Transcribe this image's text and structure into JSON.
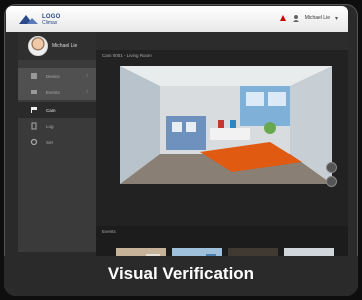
{
  "app": {
    "logo_line1": "LOGO",
    "logo_line2": "Climax"
  },
  "topbar": {
    "username": "Michael Lie"
  },
  "sidebar": {
    "profile_name": "Michael Lie",
    "items": [
      {
        "label": "Device"
      },
      {
        "label": "Events"
      },
      {
        "label": "Cam"
      },
      {
        "label": "Log"
      },
      {
        "label": "Set"
      }
    ]
  },
  "camera": {
    "title": "Cam 0001 - Living Room"
  },
  "events": {
    "label": "Events"
  },
  "caption": "Visual Verification",
  "colors": {
    "accent": "#2a4a8a",
    "panel": "#2c2c2c",
    "sidebar": "#3a3a3a"
  },
  "icons": [
    "logo-icon",
    "alert-icon",
    "user-icon",
    "device-icon",
    "event-icon",
    "camera-icon",
    "log-icon",
    "settings-icon",
    "left-arrow-icon",
    "right-arrow-icon"
  ]
}
